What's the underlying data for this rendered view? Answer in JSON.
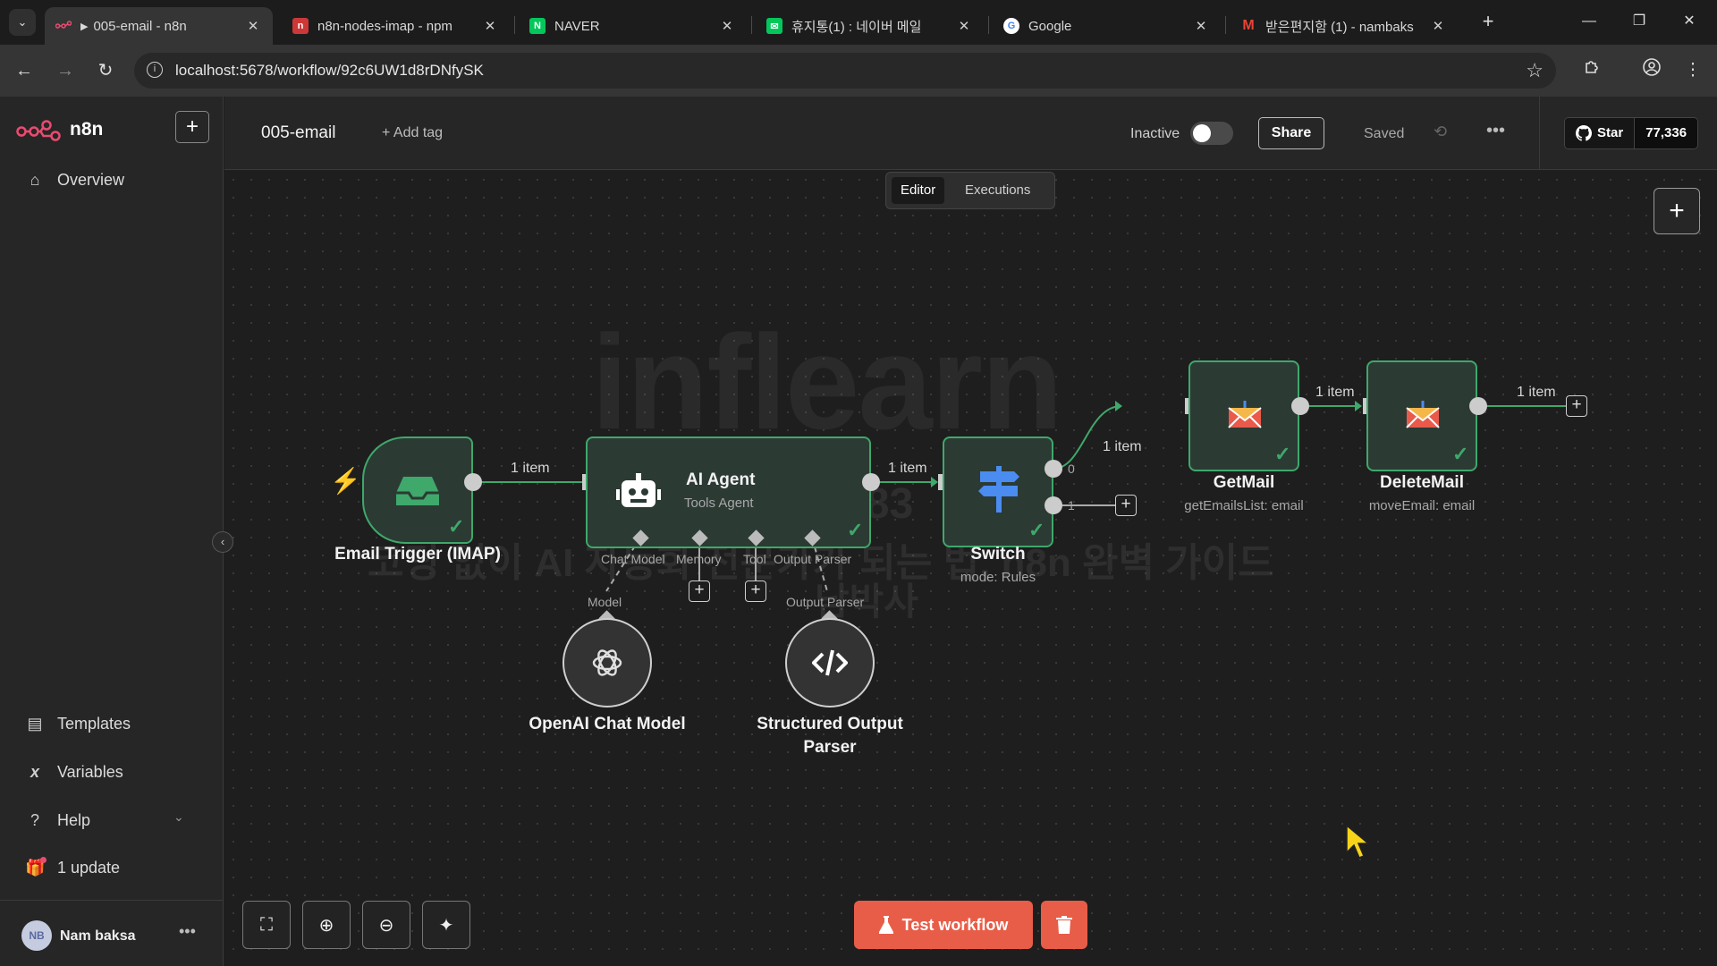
{
  "browser": {
    "tabs": [
      {
        "title": "005-email - n8n",
        "playing": "▶"
      },
      {
        "title": "n8n-nodes-imap - npm"
      },
      {
        "title": "NAVER"
      },
      {
        "title": "휴지통(1) : 네이버 메일"
      },
      {
        "title": "Google"
      },
      {
        "title": "받은편지함 (1) - nambaks"
      }
    ],
    "url": "localhost:5678/workflow/92c6UW1d8rDNfySK",
    "controls": {
      "dropdown": "⌄",
      "new_tab": "+",
      "minimize": "—",
      "restore": "❐",
      "close": "✕",
      "back": "←",
      "forward": "→",
      "reload": "↻",
      "info": "i",
      "bookmark": "☆",
      "tab_close": "✕"
    }
  },
  "sidebar": {
    "logo_text": "n8n",
    "add_button": "+",
    "collapse": "‹",
    "top_items": [
      {
        "label": "Overview",
        "icon": "home-icon"
      }
    ],
    "bottom_items": [
      {
        "label": "Templates",
        "icon": "box-icon"
      },
      {
        "label": "Variables",
        "icon": "variable-icon"
      },
      {
        "label": "Help",
        "icon": "question-icon"
      },
      {
        "label": "1 update",
        "icon": "gift-icon"
      }
    ],
    "user": {
      "initials": "NB",
      "name": "Nam baksa",
      "more": "•••"
    }
  },
  "header": {
    "workflow_name": "005-email",
    "add_tag": "+ Add tag",
    "status_label": "Inactive",
    "active": false,
    "share_label": "Share",
    "saved_label": "Saved",
    "history": "⟲",
    "more": "•••",
    "github": {
      "star_label": "Star",
      "count": "77,336"
    }
  },
  "canvas": {
    "modes": [
      {
        "label": "Editor",
        "active": true
      },
      {
        "label": "Executions",
        "active": false
      }
    ],
    "add_button": "+",
    "nodes": {
      "trigger": {
        "label": "Email Trigger (IMAP)"
      },
      "agent": {
        "label": "AI Agent",
        "sub": "Tools Agent"
      },
      "switch": {
        "label": "Switch",
        "sub": "mode: Rules"
      },
      "getmail": {
        "label": "GetMail",
        "sub": "getEmailsList: email"
      },
      "deletemail": {
        "label": "DeleteMail",
        "sub": "moveEmail: email"
      },
      "openai": {
        "label": "OpenAI Chat Model"
      },
      "parser": {
        "label": "Structured Output",
        "label2": "Parser"
      }
    },
    "connections": {
      "trigger_agent": "1 item",
      "agent_switch": "1 item",
      "switch_getmail": "1 item",
      "getmail_deletemail": "1 item",
      "deletemail_out": "1 item"
    },
    "switch_outputs": [
      "0",
      "1"
    ],
    "agent_ports": {
      "chat_model": "Chat Model",
      "memory": "Memory",
      "tool": "Tool",
      "output_parser": "Output Parser",
      "model_input": "Model",
      "parser_input": "Output Parser"
    },
    "plus": "+",
    "watermark": {
      "brand": "inflearn",
      "code": "232783",
      "line": "코딩 없이 AI 자동화 전문가가 되는 법, n8n 완벽 가이드",
      "author": "남박사"
    },
    "toolbar": {
      "fit": "⛶",
      "zoom_in": "⊕",
      "zoom_out": "⊖",
      "tidy": "✦"
    },
    "test_workflow": "Test workflow"
  }
}
